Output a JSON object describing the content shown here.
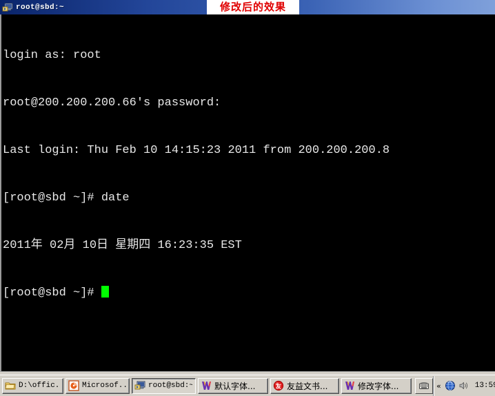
{
  "window": {
    "title": "root@sbd:~",
    "icon": "putty-icon"
  },
  "annotation": {
    "text": "修改后的效果",
    "color": "#e00000",
    "background": "#ffffff"
  },
  "terminal": {
    "background": "#000000",
    "foreground": "#e8e8e8",
    "cursor_color": "#00ff00",
    "lines": [
      "login as: root",
      "root@200.200.200.66's password:",
      "Last login: Thu Feb 10 14:15:23 2011 from 200.200.200.8",
      "[root@sbd ~]# date",
      "2011年 02月 10日 星期四 16:23:35 EST",
      "[root@sbd ~]# "
    ]
  },
  "taskbar": {
    "buttons": [
      {
        "label": "D:\\offic...",
        "icon": "folder-icon",
        "active": false,
        "cjk": false
      },
      {
        "label": "Microsof...",
        "icon": "powerpoint-icon",
        "active": false,
        "cjk": false
      },
      {
        "label": "root@sbd:~",
        "icon": "putty-icon",
        "active": true,
        "cjk": false
      },
      {
        "label": "默认字体...",
        "icon": "winword-icon",
        "active": false,
        "cjk": true
      },
      {
        "label": "友益文书...",
        "icon": "youyi-icon",
        "active": false,
        "cjk": true
      },
      {
        "label": "修改字体...",
        "icon": "winword-icon",
        "active": false,
        "cjk": true
      }
    ],
    "ime_button_icon": "keyboard-icon",
    "tray": {
      "expand_label": "«",
      "icons": [
        "globe-icon",
        "volume-icon"
      ],
      "clock": "13:59"
    }
  }
}
